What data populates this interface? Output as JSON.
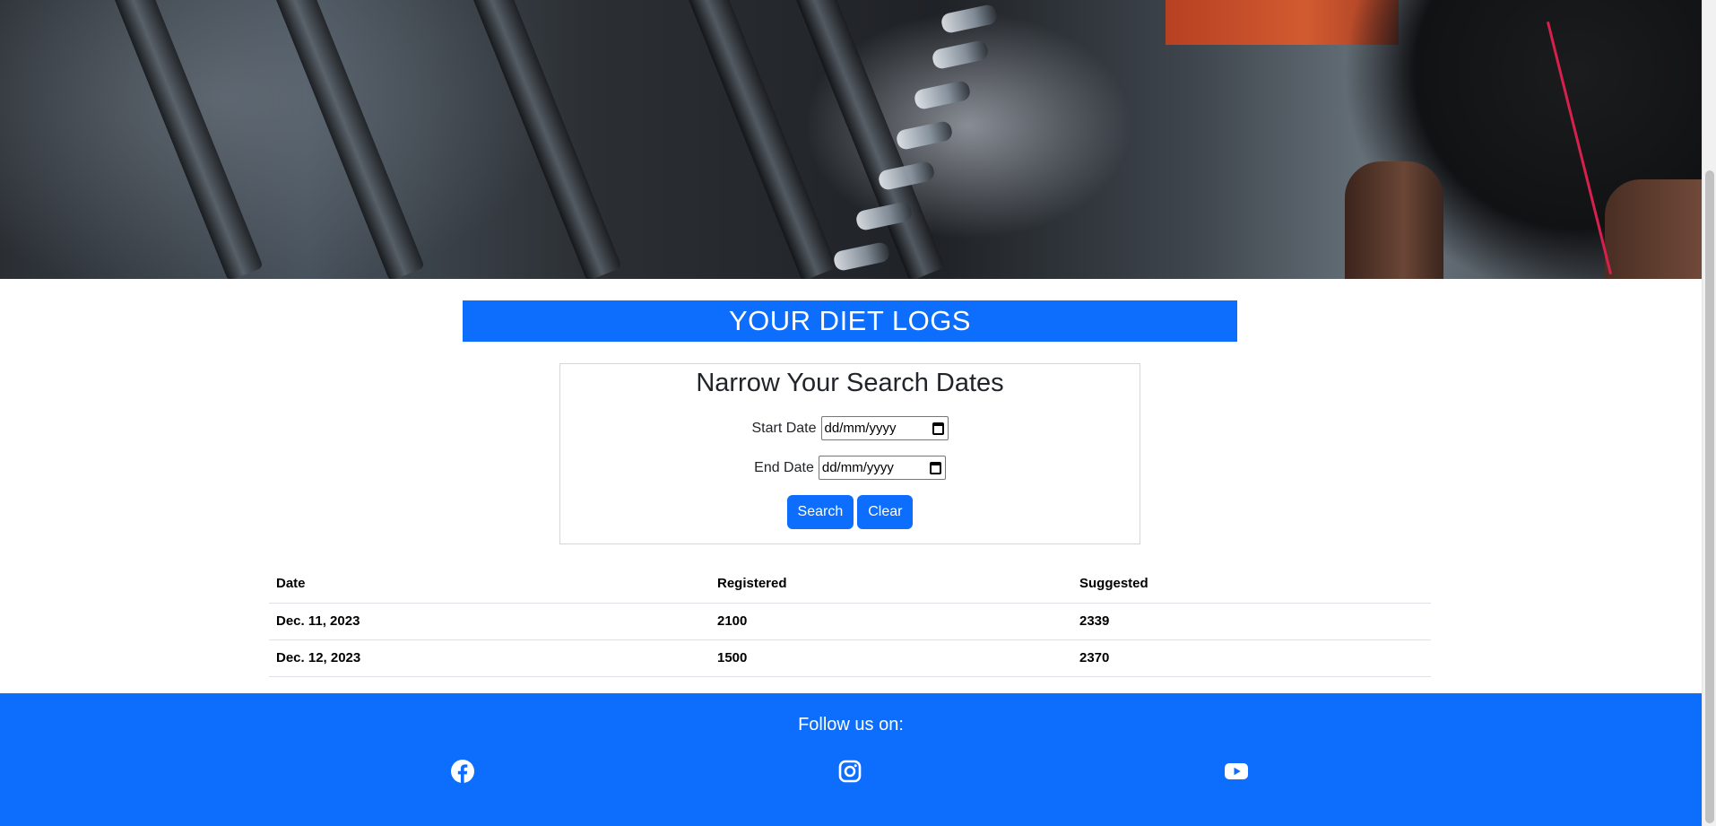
{
  "header": {
    "title": "YOUR DIET LOGS"
  },
  "search": {
    "heading": "Narrow Your Search Dates",
    "start_label": "Start Date",
    "start_placeholder": "dd/mm/yyyy",
    "end_label": "End Date",
    "end_placeholder": "dd/mm/yyyy",
    "search_label": "Search",
    "clear_label": "Clear"
  },
  "table": {
    "columns": [
      "Date",
      "Registered",
      "Suggested"
    ],
    "rows": [
      {
        "date": "Dec. 11, 2023",
        "registered": "2100",
        "suggested": "2339"
      },
      {
        "date": "Dec. 12, 2023",
        "registered": "1500",
        "suggested": "2370"
      }
    ]
  },
  "footer": {
    "follow_text": "Follow us on:",
    "social": [
      {
        "icon": "facebook-icon"
      },
      {
        "icon": "instagram-icon"
      },
      {
        "icon": "youtube-icon"
      }
    ]
  },
  "colors": {
    "brand_blue": "#0d6efd",
    "text": "#212529",
    "white": "#ffffff"
  }
}
